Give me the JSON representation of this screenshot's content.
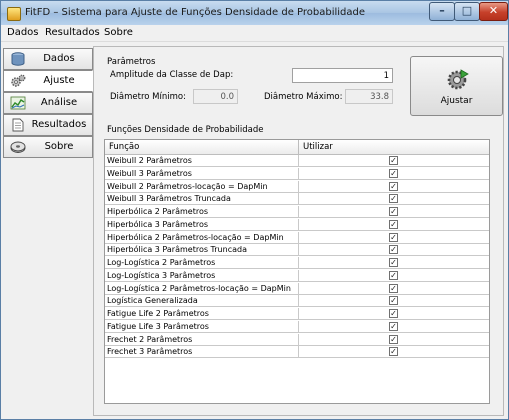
{
  "window": {
    "title": "FitFD – Sistema para Ajuste de Funções Densidade de Probabilidade",
    "min_glyph": "–",
    "max_glyph": "□",
    "close_glyph": "✕"
  },
  "menu": [
    "Dados",
    "Resultados",
    "Sobre"
  ],
  "sidebar": {
    "active": "Ajuste",
    "items": [
      {
        "label": "Dados",
        "icon": "database-icon"
      },
      {
        "label": "Ajuste",
        "icon": "gears-icon"
      },
      {
        "label": "Análise",
        "icon": "chart-icon"
      },
      {
        "label": "Resultados",
        "icon": "document-icon"
      },
      {
        "label": "Sobre",
        "icon": "disc-icon"
      }
    ]
  },
  "params": {
    "group_title": "Parâmetros",
    "amplitude_label": "Amplitude da Classe de Dap:",
    "amplitude_value": "1",
    "dmin_label": "Diâmetro Mínimo:",
    "dmin_value": "0.0",
    "dmax_label": "Diâmetro Máximo:",
    "dmax_value": "33.8"
  },
  "ajustar_button": {
    "label": "Ajustar",
    "icon": "gear-run-icon"
  },
  "functions": {
    "group_title": "Funções Densidade de Probabilidade",
    "columns": [
      "Função",
      "Utilizar"
    ],
    "rows": [
      {
        "name": "Weibull 2 Parâmetros",
        "checked": true
      },
      {
        "name": "Weibull 3 Parâmetros",
        "checked": true
      },
      {
        "name": "Weibull 2 Parâmetros-locação = DapMin",
        "checked": true
      },
      {
        "name": "Weibull 3 Parâmetros Truncada",
        "checked": true
      },
      {
        "name": "Hiperbólica 2 Parâmetros",
        "checked": true
      },
      {
        "name": "Hiperbólica 3 Parâmetros",
        "checked": true
      },
      {
        "name": "Hiperbólica 2 Parâmetros-locação = DapMin",
        "checked": true
      },
      {
        "name": "Hiperbólica 3 Parâmetros Truncada",
        "checked": true
      },
      {
        "name": "Log-Logística 2 Parâmetros",
        "checked": true
      },
      {
        "name": "Log-Logística 3 Parâmetros",
        "checked": true
      },
      {
        "name": "Log-Logística 2 Parâmetros-locação = DapMin",
        "checked": true
      },
      {
        "name": "Logística Generalizada",
        "checked": true
      },
      {
        "name": "Fatigue Life 2 Parâmetros",
        "checked": true
      },
      {
        "name": "Fatigue Life 3 Parâmetros",
        "checked": true
      },
      {
        "name": "Frechet 2 Parâmetros",
        "checked": true
      },
      {
        "name": "Frechet 3 Parâmetros",
        "checked": true
      }
    ]
  },
  "check_glyph": "✓"
}
